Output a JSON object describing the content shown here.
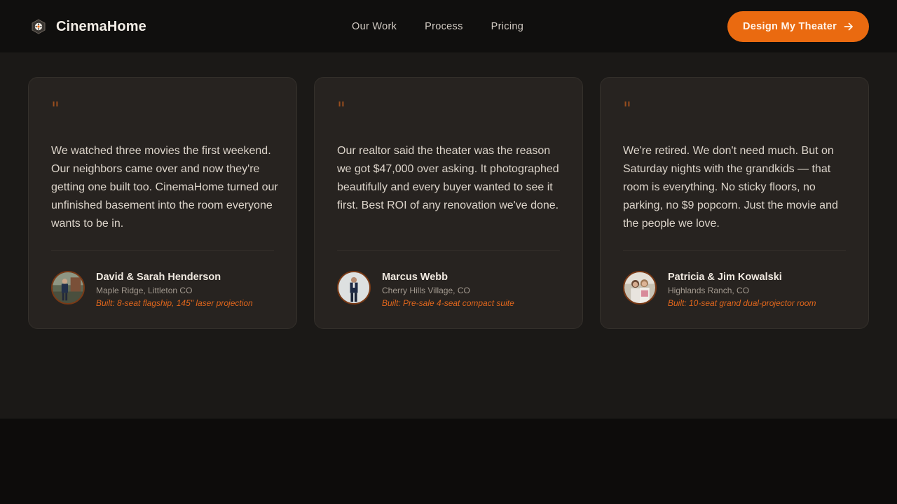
{
  "header": {
    "brand_name": "CinemaHome",
    "nav": [
      {
        "label": "Our Work"
      },
      {
        "label": "Process"
      },
      {
        "label": "Pricing"
      }
    ],
    "cta_label": "Design My Theater",
    "cta_icon": "arrow-right-icon"
  },
  "colors": {
    "accent": "#ea6a10",
    "page_bg": "#0d0c0b",
    "section_bg": "#1b1917",
    "card_bg": "#272320"
  },
  "testimonials": [
    {
      "quote_mark": "\"",
      "quote": "We watched three movies the first weekend. Our neighbors came over and now they're getting one built too. CinemaHome turned our unfinished basement into the room everyone wants to be in.",
      "name": "David & Sarah Henderson",
      "location": "Maple Ridge, Littleton CO",
      "built": "Built: 8-seat flagship, 145\" laser projection"
    },
    {
      "quote_mark": "\"",
      "quote": "Our realtor said the theater was the reason we got $47,000 over asking. It photographed beautifully and every buyer wanted to see it first. Best ROI of any renovation we've done.",
      "name": "Marcus Webb",
      "location": "Cherry Hills Village, CO",
      "built": "Built: Pre-sale 4-seat compact suite"
    },
    {
      "quote_mark": "\"",
      "quote": "We're retired. We don't need much. But on Saturday nights with the grandkids — that room is everything. No sticky floors, no parking, no $9 popcorn. Just the movie and the people we love.",
      "name": "Patricia & Jim Kowalski",
      "location": "Highlands Ranch, CO",
      "built": "Built: 10-seat grand dual-projector room"
    }
  ]
}
